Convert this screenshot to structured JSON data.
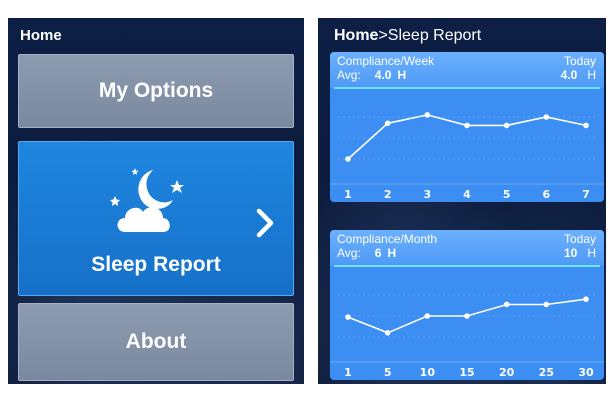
{
  "left": {
    "title": "Home",
    "buttons": {
      "options": "My Options",
      "sleep": "Sleep Report",
      "about": "About"
    }
  },
  "right": {
    "breadcrumb": {
      "home": "Home",
      "sep": ">",
      "current": "Sleep Report"
    }
  },
  "icons": {
    "sleep": "moon-stars-cloud-icon",
    "chevron": "chevron-right-icon"
  },
  "colors": {
    "active": "#1f86e0",
    "inactive": "#8d9bb0",
    "card": "#3d8ef2",
    "line": "#ffffff"
  },
  "chart_data": [
    {
      "type": "line",
      "title": "Compliance/Week",
      "avg_label": "Avg:",
      "avg_value": "4.0",
      "unit": "H",
      "today_label": "Today",
      "today_value": "4.0",
      "x": [
        "1",
        "2",
        "3",
        "4",
        "5",
        "6",
        "7"
      ],
      "values": [
        2.0,
        5.4,
        6.2,
        5.2,
        5.2,
        6.0,
        5.2
      ],
      "ylim": [
        0,
        8
      ]
    },
    {
      "type": "line",
      "title": "Compliance/Month",
      "avg_label": "Avg:",
      "avg_value": "6",
      "unit": "H",
      "today_label": "Today",
      "today_value": "10",
      "x": [
        "1",
        "5",
        "10",
        "15",
        "20",
        "25",
        "30"
      ],
      "values": [
        3.9,
        2.4,
        4.0,
        4.0,
        5.1,
        5.1,
        5.6
      ],
      "ylim": [
        0,
        8
      ]
    }
  ]
}
